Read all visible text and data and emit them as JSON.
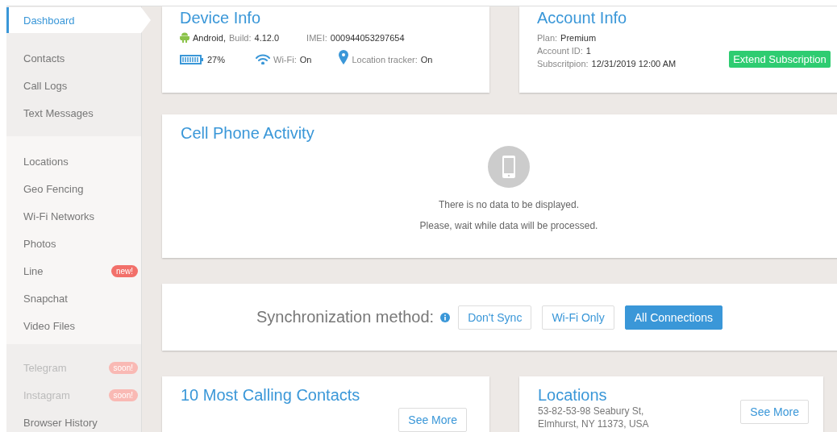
{
  "sidebar": {
    "groups": [
      {
        "items": [
          {
            "label": "Dashboard",
            "selected": true,
            "disabled": false
          }
        ]
      },
      {
        "items": [
          {
            "label": "Contacts",
            "selected": false,
            "disabled": false
          },
          {
            "label": "Call Logs",
            "selected": false,
            "disabled": false
          },
          {
            "label": "Text Messages",
            "selected": false,
            "disabled": false
          }
        ]
      },
      {
        "items": [
          {
            "label": "Locations",
            "selected": false,
            "disabled": false
          },
          {
            "label": "Geo Fencing",
            "selected": false,
            "disabled": false
          },
          {
            "label": "Wi-Fi Networks",
            "selected": false,
            "disabled": false
          },
          {
            "label": "Photos",
            "selected": false,
            "disabled": false
          },
          {
            "label": "Line",
            "selected": false,
            "disabled": false,
            "badge": "new!"
          },
          {
            "label": "Snapchat",
            "selected": false,
            "disabled": false
          },
          {
            "label": "Video Files",
            "selected": false,
            "disabled": false
          }
        ]
      },
      {
        "items": [
          {
            "label": "Telegram",
            "selected": false,
            "disabled": true,
            "badge": "soon!"
          },
          {
            "label": "Instagram",
            "selected": false,
            "disabled": true,
            "badge": "soon!"
          },
          {
            "label": "Browser History",
            "selected": false,
            "disabled": false
          }
        ]
      }
    ]
  },
  "device_info": {
    "title": "Device Info",
    "os": "Android,",
    "build_label": "Build:",
    "build": "4.12.0",
    "imei_label": "IMEI:",
    "imei": "000944053297654",
    "battery": "27%",
    "wifi_label": "Wi-Fi:",
    "wifi": "On",
    "tracker_label": "Location tracker:",
    "tracker": "On"
  },
  "account_info": {
    "title": "Account Info",
    "fields": [
      {
        "label": "Plan:",
        "value": "Premium"
      },
      {
        "label": "Account ID:",
        "value": "1"
      },
      {
        "label": "Subscritpion:",
        "value": "12/31/2019 12:00 AM"
      }
    ],
    "button": "Extend Subscription"
  },
  "activity": {
    "title": "Cell Phone Activity",
    "messages": [
      "There is no data to be displayed.",
      "Please, wait while data will be processed."
    ]
  },
  "sync": {
    "label": "Synchronization method:",
    "options": [
      {
        "label": "Don't Sync",
        "selected": false
      },
      {
        "label": "Wi-Fi Only",
        "selected": false
      },
      {
        "label": "All Connections",
        "selected": true
      }
    ]
  },
  "contacts_card": {
    "title": "10 Most Calling Contacts",
    "button": "See More"
  },
  "locations_card": {
    "title": "Locations",
    "address": [
      "53-82-53-98 Seabury St,",
      "Elmhurst, NY 11373, USA"
    ],
    "button": "See More"
  }
}
